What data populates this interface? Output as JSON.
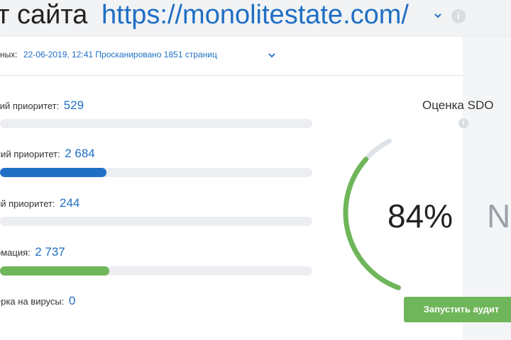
{
  "header": {
    "title_prefix": "т сайта",
    "site_url": "https://monolitestate.com/",
    "info_icon": "info-icon",
    "chevron_icon": "chevron-down-icon"
  },
  "scan": {
    "label": "ных:",
    "value": "22-06-2019, 12:41 Просканировано 1851 страниц"
  },
  "metrics": [
    {
      "label": "кий приоритет:",
      "value": "529",
      "fill": 0,
      "color": "#1f6fc4"
    },
    {
      "label": "ний приоритет:",
      "value": "2 684",
      "fill": 0.34,
      "color": "#1f6fc4"
    },
    {
      "label": "ий приоритет:",
      "value": "244",
      "fill": 0,
      "color": "#1f6fc4"
    },
    {
      "label": "омация:",
      "value": "2 737",
      "fill": 0.35,
      "color": "#6fb65a"
    },
    {
      "label": "ерка на вирусы:",
      "value": "0"
    }
  ],
  "score": {
    "title": "Оценка SDO",
    "value": "84%",
    "percent": 84,
    "next_partial": "N",
    "color": "#6fb65a",
    "track_color": "#dfe3e8"
  },
  "actions": {
    "run_audit": "Запустить аудит"
  }
}
